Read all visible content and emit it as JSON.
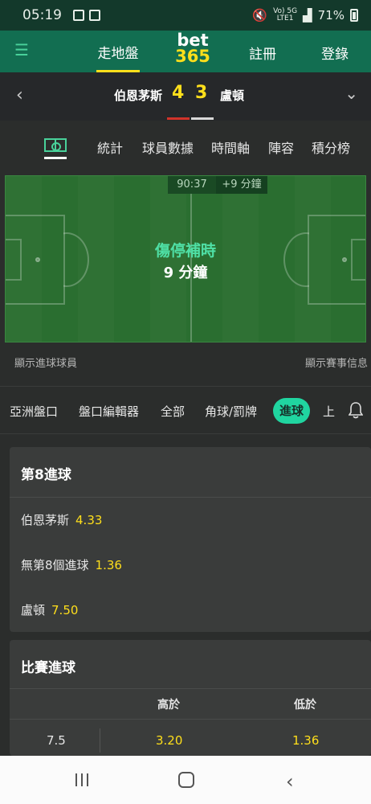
{
  "status": {
    "time": "05:19",
    "network_top": "Vo) 5G",
    "network_bottom": "LTE1",
    "battery": "71%"
  },
  "topnav": {
    "menu_icon": "menu-icon",
    "live_label": "走地盤",
    "logo_line1": "bet",
    "logo_line2": "365",
    "register_label": "註冊",
    "login_label": "登錄"
  },
  "score": {
    "home_team": "伯恩茅斯",
    "home_score": "4",
    "away_score": "3",
    "away_team": "盧頓"
  },
  "stat_tabs": [
    "統計",
    "球員數據",
    "時間軸",
    "陣容",
    "積分榜"
  ],
  "pitch": {
    "clock": "90:37",
    "added_time": "+9 分鐘",
    "title": "傷停補時",
    "subtitle": "9 分鐘"
  },
  "links": {
    "show_scorers": "顯示進球球員",
    "show_match_info": "顯示賽事信息"
  },
  "market_tabs": [
    "亞洲盤口",
    "盤口編輯器",
    "全部",
    "角球/罰牌",
    "進球",
    "上"
  ],
  "card1": {
    "title": "第8進球",
    "rows": [
      {
        "label": "伯恩茅斯",
        "odds": "4.33"
      },
      {
        "label": "無第8個進球",
        "odds": "1.36"
      },
      {
        "label": "盧頓",
        "odds": "7.50"
      }
    ]
  },
  "card2": {
    "title": "比賽進球",
    "headers": {
      "over": "高於",
      "under": "低於"
    },
    "rows": [
      {
        "line": "7.5",
        "over": "3.20",
        "under": "1.36"
      }
    ]
  },
  "colors": {
    "brand_green": "#126e51",
    "accent_yellow": "#ffdf1b",
    "active_tab": "#20d5a0"
  }
}
